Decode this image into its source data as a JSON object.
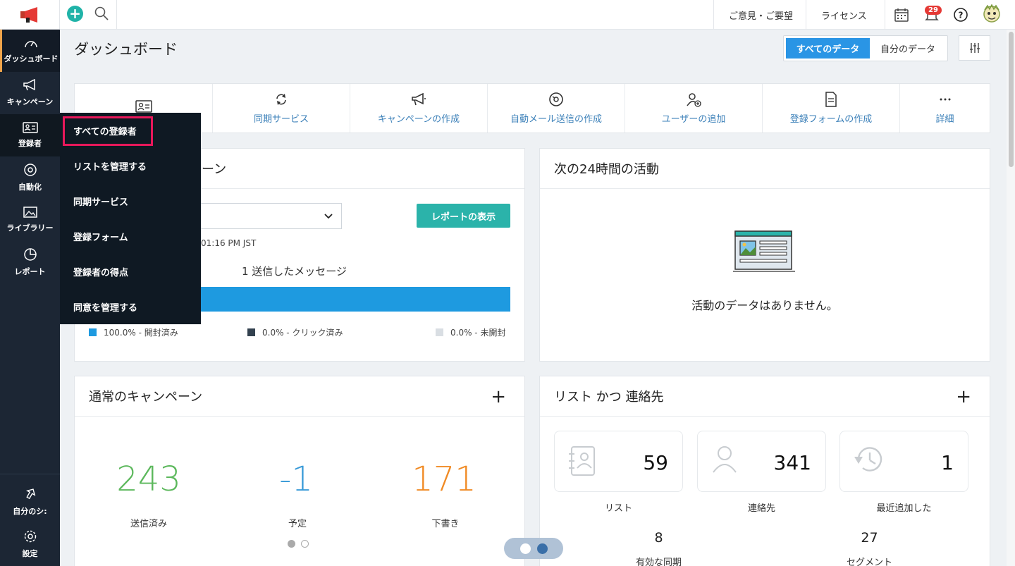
{
  "topbar": {
    "feedback": "ご意見・ご要望",
    "license": "ライセンス",
    "notifications_count": "29"
  },
  "sidebar": {
    "items": [
      {
        "label": "ダッシュボード",
        "icon": "gauge-icon"
      },
      {
        "label": "キャンペーン",
        "icon": "megaphone-icon"
      },
      {
        "label": "登録者",
        "icon": "contact-card-icon"
      },
      {
        "label": "自動化",
        "icon": "automation-icon"
      },
      {
        "label": "ライブラリー",
        "icon": "image-icon"
      },
      {
        "label": "レポート",
        "icon": "pie-chart-icon"
      }
    ],
    "bottom": [
      {
        "label": "自分のシ:",
        "icon": "share-icon"
      },
      {
        "label": "設定",
        "icon": "gear-icon"
      }
    ]
  },
  "flyout": {
    "items": [
      "すべての登録者",
      "リストを管理する",
      "同期サービス",
      "登録フォーム",
      "登録者の得点",
      "同意を管理する"
    ]
  },
  "header": {
    "title": "ダッシュボード",
    "toggle_all": "すべてのデータ",
    "toggle_mine": "自分のデータ"
  },
  "quick_actions": [
    {
      "label": "",
      "icon": "contact-card-icon"
    },
    {
      "label": "同期サービス",
      "icon": "sync-icon"
    },
    {
      "label": "キャンペーンの作成",
      "icon": "megaphone-icon"
    },
    {
      "label": "自動メール送信の作成",
      "icon": "automation-icon"
    },
    {
      "label": "ユーザーの追加",
      "icon": "add-user-icon"
    },
    {
      "label": "登録フォームの作成",
      "icon": "document-icon"
    },
    {
      "label": "詳細",
      "icon": "more-icon"
    }
  ],
  "recent_campaign": {
    "title_visible": "ーン",
    "timestamp": "01:16 PM JST",
    "report_button": "レポートの表示",
    "sent_message": "1 送信したメッセージ",
    "legend": [
      {
        "label": "100.0% - 開封済み",
        "color": "#1e9ae0"
      },
      {
        "label": "0.0% - クリック済み",
        "color": "#33414f"
      },
      {
        "label": "0.0% - 未開封",
        "color": "#d9dee3"
      }
    ],
    "open_ratio": 1.0
  },
  "activity": {
    "title": "次の24時間の活動",
    "empty_text": "活動のデータはありません。"
  },
  "normal_campaigns": {
    "title": "通常のキャンペーン",
    "stats": [
      {
        "value": "243",
        "label": "送信済み",
        "color": "#5cb85c"
      },
      {
        "value": "-1",
        "label": "予定",
        "color": "#3a9bd8"
      },
      {
        "value": "171",
        "label": "下書き",
        "color": "#f08a24"
      }
    ]
  },
  "lists_contacts": {
    "title": "リスト かつ 連絡先",
    "boxes": [
      {
        "value": "59",
        "label": "リスト",
        "icon": "list-contact-icon"
      },
      {
        "value": "341",
        "label": "連絡先",
        "icon": "user-icon"
      },
      {
        "value": "1",
        "label": "最近追加した",
        "icon": "history-icon"
      }
    ],
    "small": [
      {
        "value": "8",
        "label": "有効な同期"
      },
      {
        "value": "27",
        "label": "セグメント"
      }
    ]
  }
}
